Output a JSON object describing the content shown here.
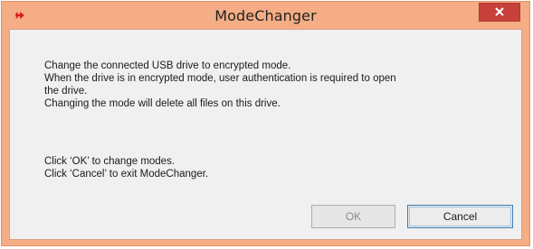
{
  "window": {
    "title": "ModeChanger",
    "accent_color": "#f5ad85",
    "close_color": "#c7413b",
    "icon": "red-arrow-icon"
  },
  "message": {
    "line1": "Change the connected USB drive to encrypted mode.",
    "line2": "When the drive is in encrypted mode, user authentication is required to open",
    "line3": "the drive.",
    "line4": "Changing the mode will delete all files on this drive.",
    "line5": "Click ‘OK’ to change modes.",
    "line6": "Click ‘Cancel’ to exit ModeChanger."
  },
  "buttons": {
    "ok_label": "OK",
    "cancel_label": "Cancel"
  }
}
